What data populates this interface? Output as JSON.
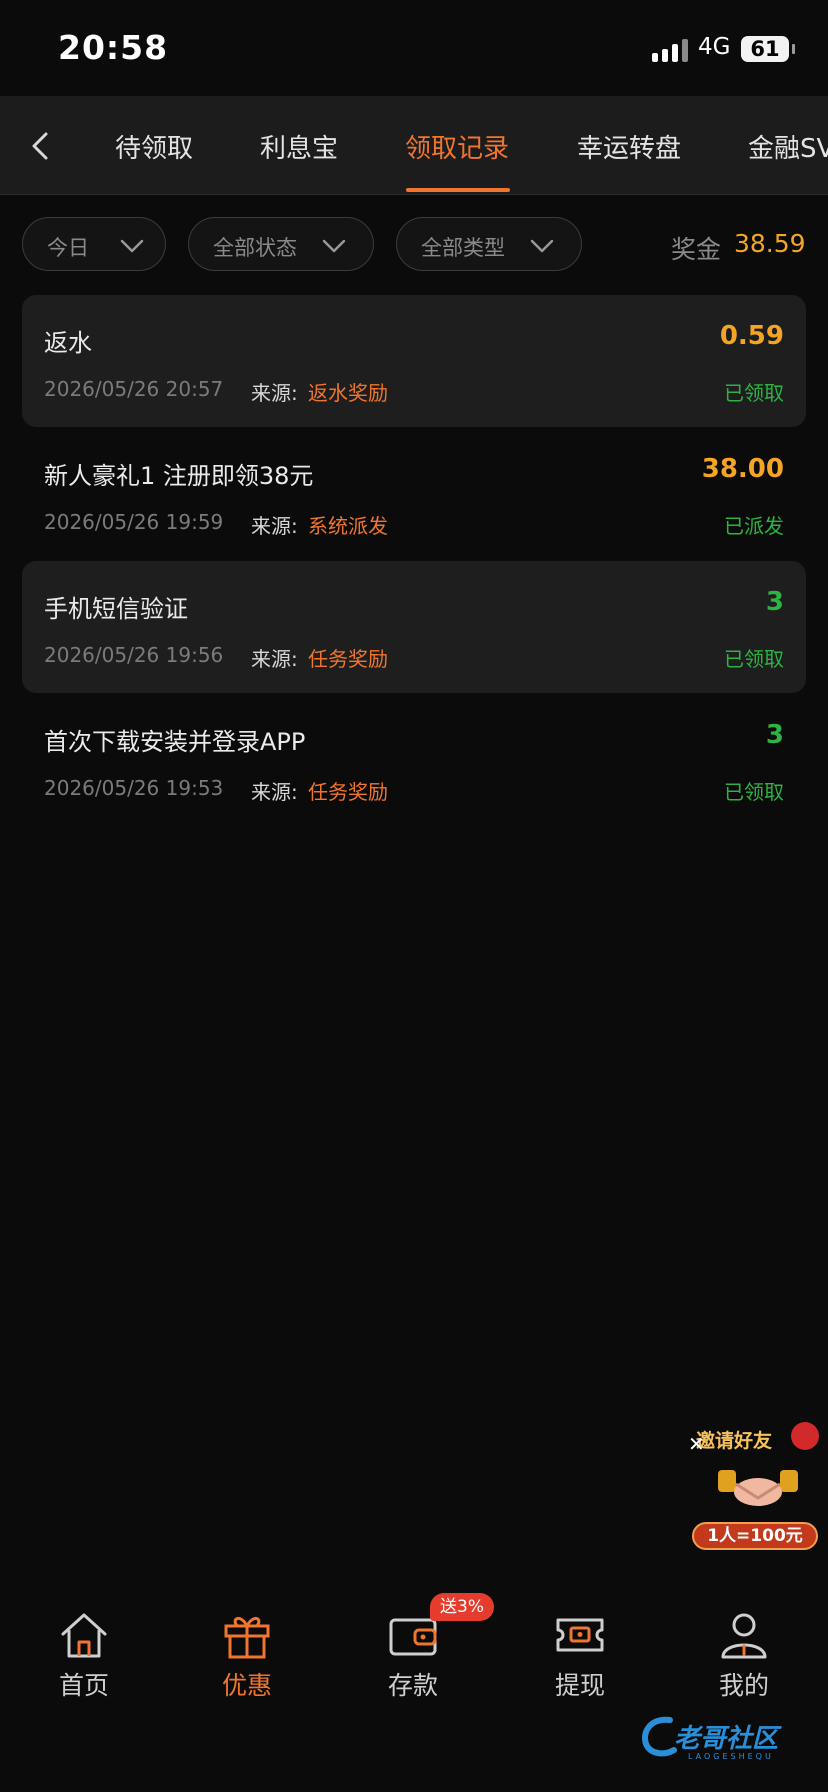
{
  "status_bar": {
    "time": "20:58",
    "network": "4G",
    "battery": "61"
  },
  "tabs": [
    {
      "label": "待领取",
      "active": false
    },
    {
      "label": "利息宝",
      "active": false
    },
    {
      "label": "领取记录",
      "active": true
    },
    {
      "label": "幸运转盘",
      "active": false
    },
    {
      "label": "金融SV",
      "active": false
    }
  ],
  "filters": {
    "date": "今日",
    "status": "全部状态",
    "type": "全部类型"
  },
  "bonus": {
    "label": "奖金",
    "value": "38.59"
  },
  "records": [
    {
      "title": "返水",
      "amount": "0.59",
      "amount_color": "orange",
      "time": "2026/05/26 20:57",
      "source_label": "来源:",
      "source": "返水奖励",
      "status": "已领取"
    },
    {
      "title": "新人豪礼1 注册即领38元",
      "amount": "38.00",
      "amount_color": "orange",
      "time": "2026/05/26 19:59",
      "source_label": "来源:",
      "source": "系统派发",
      "status": "已派发"
    },
    {
      "title": "手机短信验证",
      "amount": "3",
      "amount_color": "green",
      "time": "2026/05/26 19:56",
      "source_label": "来源:",
      "source": "任务奖励",
      "status": "已领取"
    },
    {
      "title": "首次下载安装并登录APP",
      "amount": "3",
      "amount_color": "green",
      "time": "2026/05/26 19:53",
      "source_label": "来源:",
      "source": "任务奖励",
      "status": "已领取"
    }
  ],
  "promo": {
    "title": "邀请好友",
    "reward": "1人=100元"
  },
  "bottom_nav": [
    {
      "label": "首页",
      "icon": "home-icon",
      "active": false
    },
    {
      "label": "优惠",
      "icon": "gift-icon",
      "active": true
    },
    {
      "label": "存款",
      "icon": "wallet-icon",
      "active": false,
      "badge": "送3%"
    },
    {
      "label": "提现",
      "icon": "withdraw-ticket-icon",
      "active": false
    },
    {
      "label": "我的",
      "icon": "profile-icon",
      "active": false
    }
  ],
  "watermark": {
    "text": "老哥社区",
    "sub": "LAOGESHEQU"
  },
  "colors": {
    "accent": "#f0752e",
    "bonus": "#f5a524",
    "success": "#2db341",
    "background": "#0b0b0b",
    "card": "#1e1e1e"
  }
}
